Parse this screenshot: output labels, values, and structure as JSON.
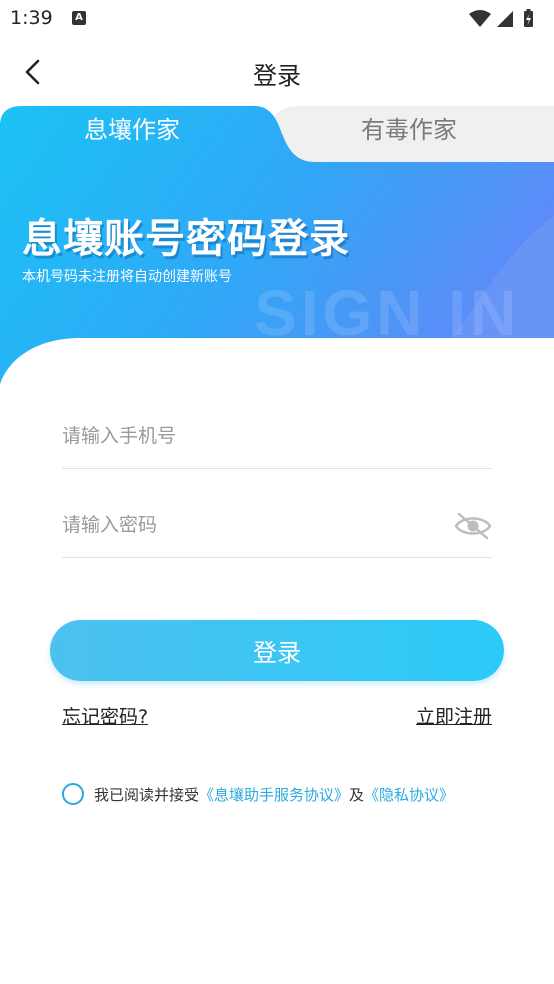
{
  "status_bar": {
    "time": "1:39",
    "notification_icon": "A"
  },
  "nav": {
    "title": "登录"
  },
  "tabs": [
    {
      "label": "息壤作家"
    },
    {
      "label": "有毒作家"
    }
  ],
  "banner": {
    "title": "息壤账号密码登录",
    "subtitle": "本机号码未注册将自动创建新账号",
    "watermark": "SIGN IN"
  },
  "form": {
    "phone_placeholder": "请输入手机号",
    "password_placeholder": "请输入密码",
    "submit_label": "登录"
  },
  "links": {
    "forgot": "忘记密码?",
    "register": "立即注册"
  },
  "agreement": {
    "prefix": "我已阅读并接受",
    "service_link": "《息壤助手服务协议》",
    "conjunction": "及",
    "privacy_link": "《隐私协议》"
  },
  "colors": {
    "accent": "#2aa9e0",
    "banner_start": "#1bc3f5",
    "banner_end": "#5b8cf7"
  }
}
